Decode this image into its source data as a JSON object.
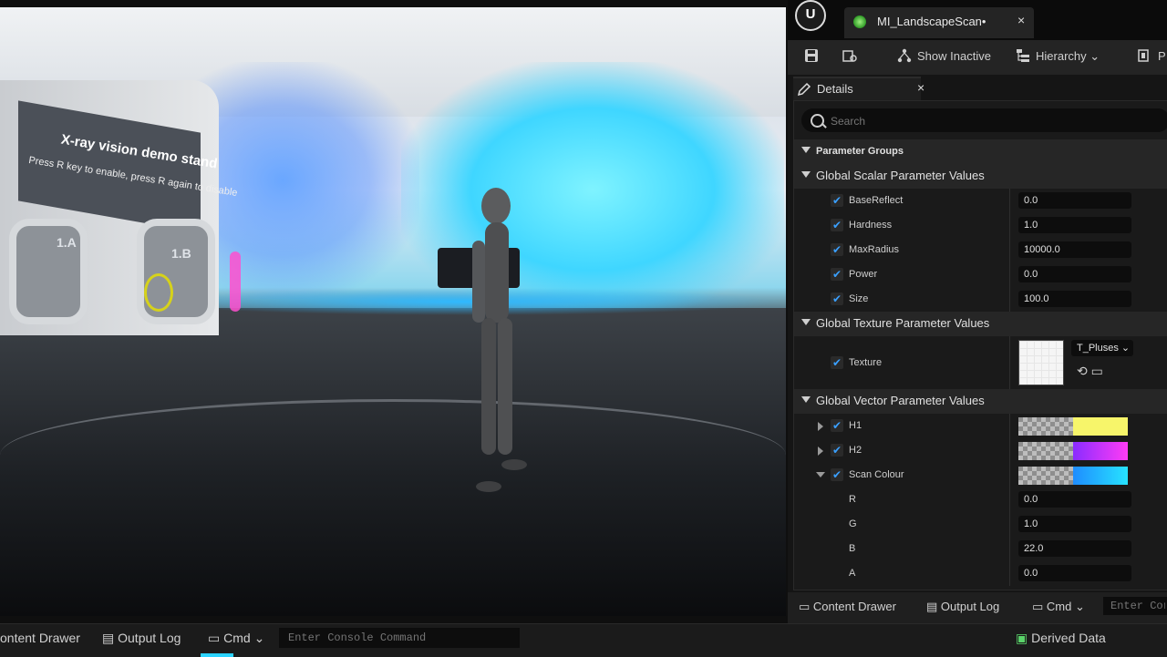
{
  "viewport": {
    "sign_title": "X-ray vision demo stand",
    "sign_subtitle": "Press R key to enable, press R again to disable",
    "alcove_labels": [
      "1.A",
      "1.B"
    ]
  },
  "editor": {
    "asset_tab": {
      "title": "MI_LandscapeScan•",
      "close": "×"
    },
    "toolbar": {
      "show_inactive": "Show Inactive",
      "hierarchy": "Hierarchy",
      "more": "P"
    },
    "details": {
      "tab_title": "Details",
      "close": "×",
      "search_placeholder": "Search",
      "parameter_groups": "Parameter Groups",
      "scalar_group": "Global Scalar Parameter Values",
      "scalars": [
        {
          "name": "BaseReflect",
          "value": "0.0"
        },
        {
          "name": "Hardness",
          "value": "1.0"
        },
        {
          "name": "MaxRadius",
          "value": "10000.0"
        },
        {
          "name": "Power",
          "value": "0.0"
        },
        {
          "name": "Size",
          "value": "100.0"
        }
      ],
      "texture_group": "Global Texture Parameter Values",
      "texture": {
        "name": "Texture",
        "asset": "T_Pluses"
      },
      "vector_group": "Global Vector Parameter Values",
      "vectors": [
        {
          "name": "H1",
          "color": "#f7f56a"
        },
        {
          "name": "H2",
          "color": "#c43cff"
        },
        {
          "name": "Scan Colour",
          "color": "#25c8ff"
        }
      ],
      "scan_channels": [
        {
          "name": "R",
          "value": "0.0"
        },
        {
          "name": "G",
          "value": "1.0"
        },
        {
          "name": "B",
          "value": "22.0"
        },
        {
          "name": "A",
          "value": "0.0"
        }
      ]
    },
    "footer": {
      "content_drawer": "Content Drawer",
      "output_log": "Output Log",
      "cmd": "Cmd",
      "console_placeholder": "Enter Cor"
    }
  },
  "statusbar": {
    "content_drawer": "ontent Drawer",
    "output_log": "Output Log",
    "cmd": "Cmd",
    "console_placeholder": "Enter Console Command",
    "derived_data": "Derived Data"
  },
  "colors": {
    "accent_blue": "#3aa0ff",
    "scan_cyan": "#2bd3ff"
  }
}
